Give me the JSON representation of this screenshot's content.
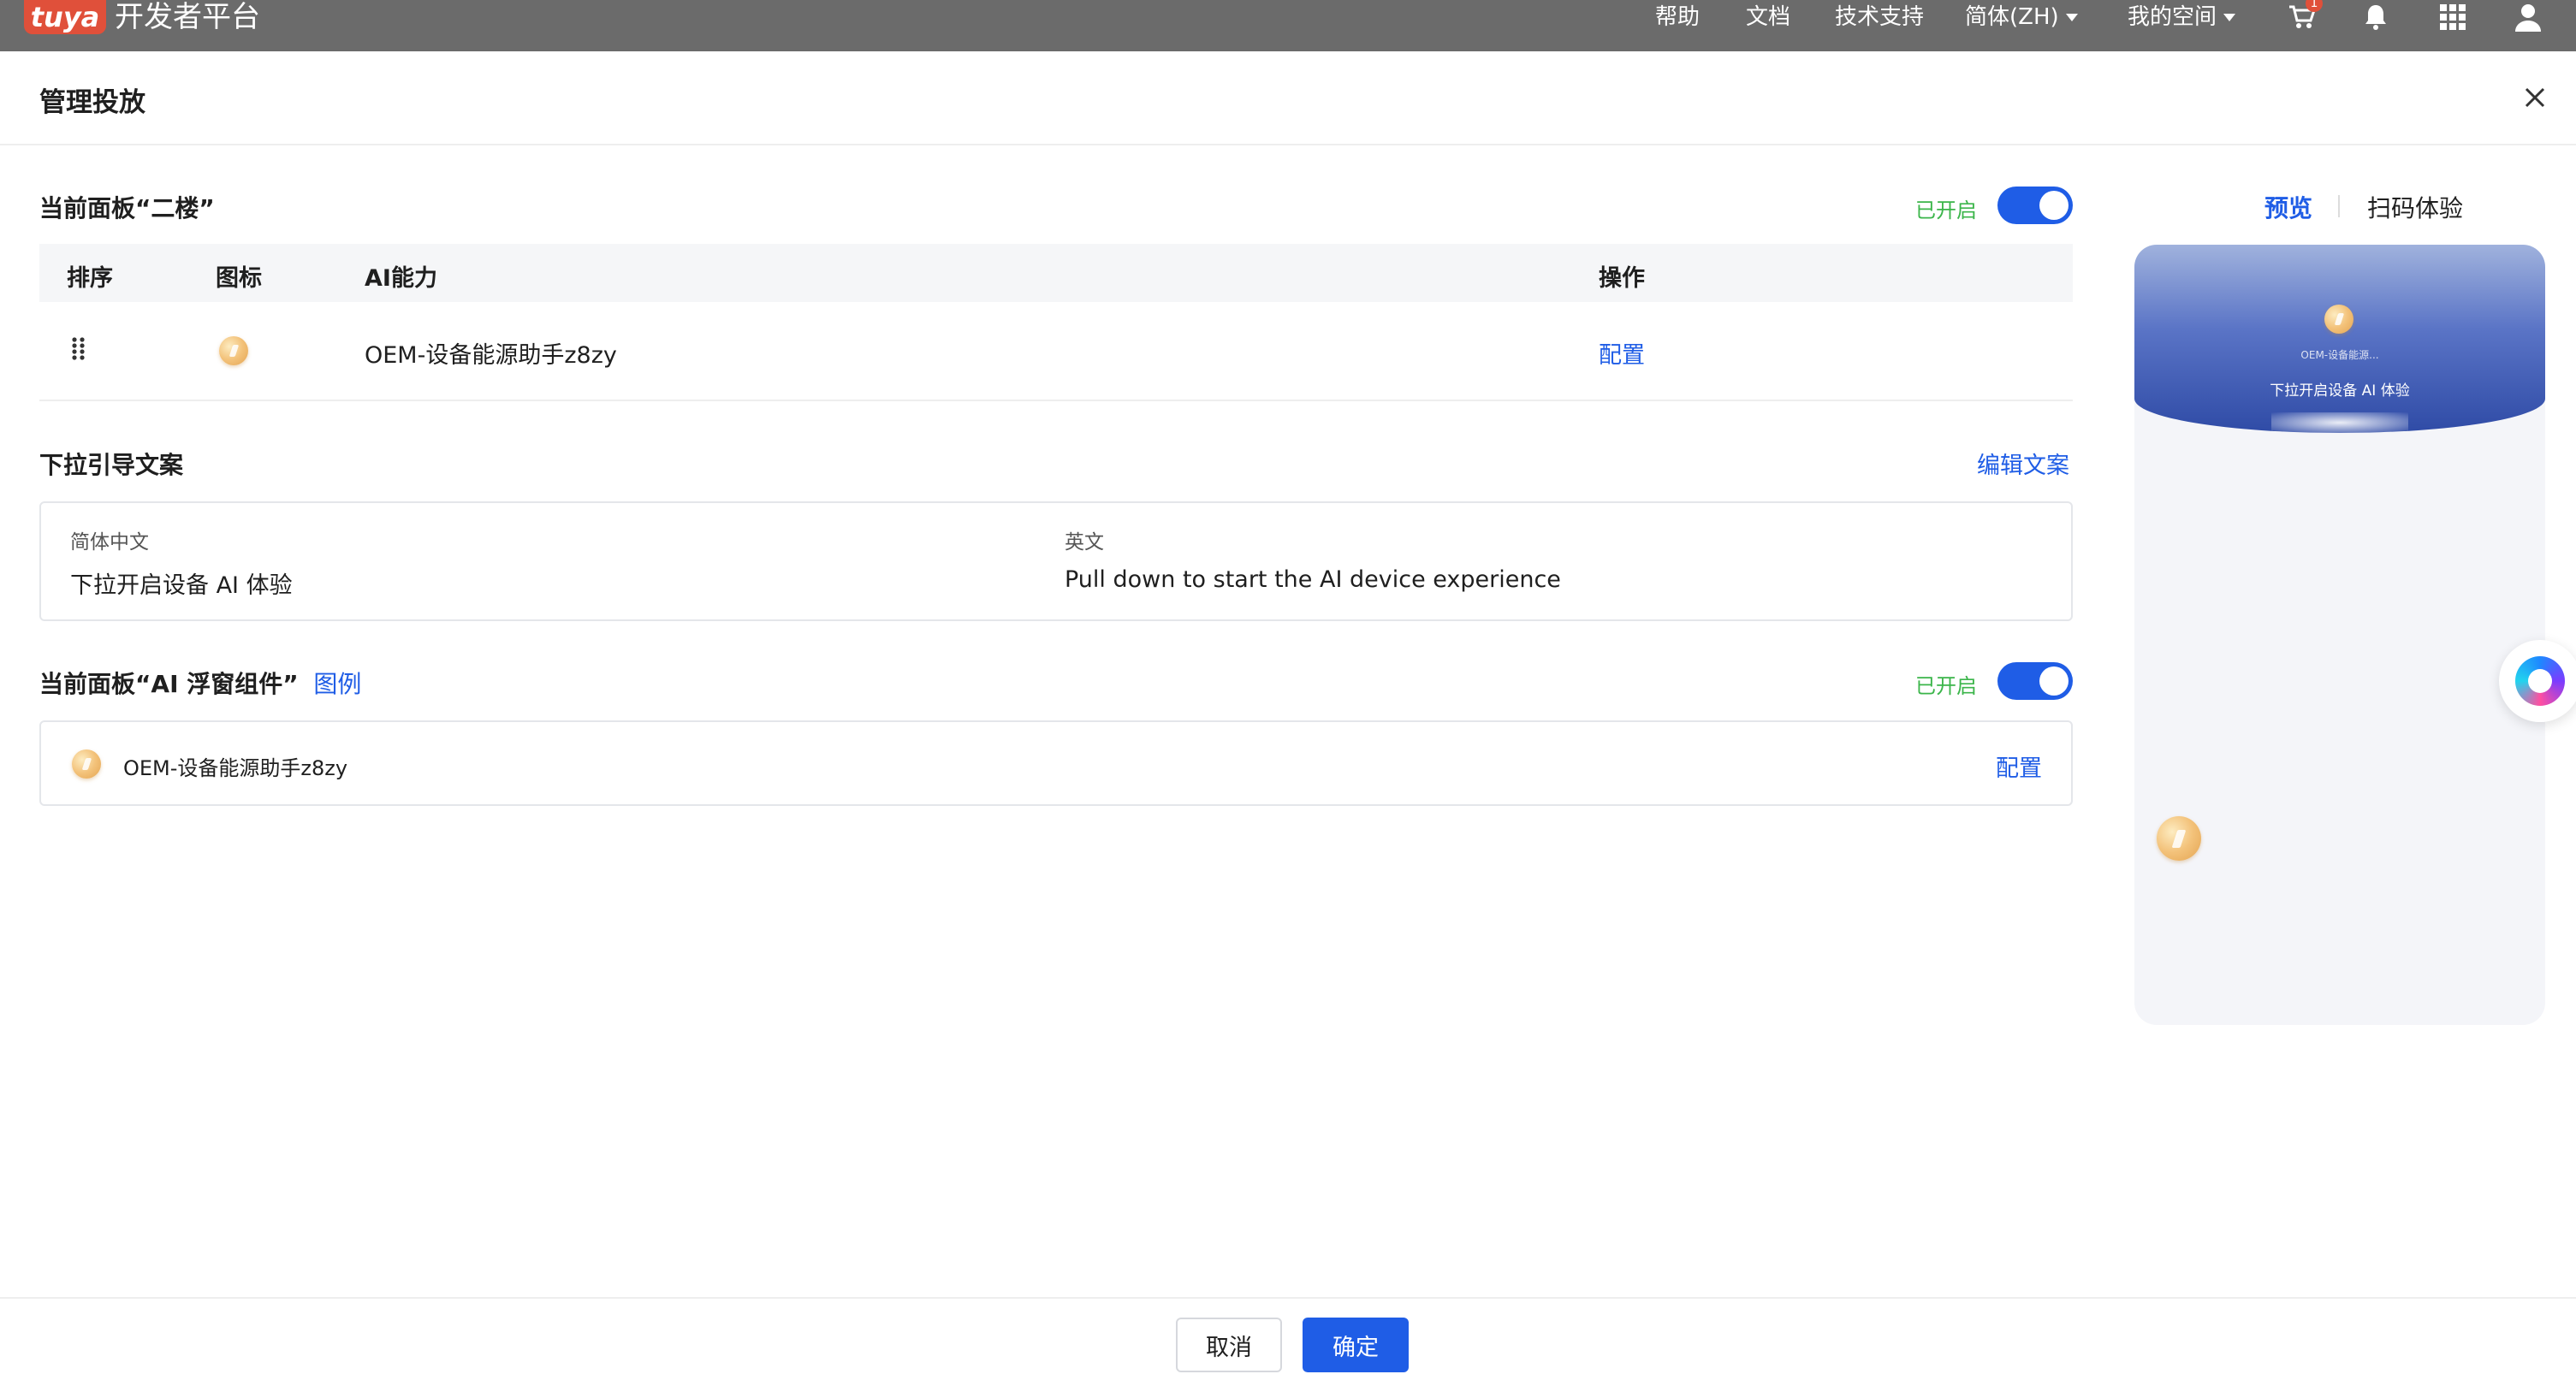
{
  "topbar": {
    "logo_text": "tuya",
    "brand": "开发者平台",
    "nav": [
      "帮助",
      "文档",
      "技术支持"
    ],
    "language": "简体(ZH)",
    "workspace": "我的空间",
    "cart_badge": "1",
    "icons": [
      "cart-icon",
      "bell-icon",
      "apps-grid-icon",
      "user-icon"
    ]
  },
  "modal": {
    "title": "管理投放"
  },
  "panel1": {
    "title": "当前面板“二楼”",
    "status": "已开启",
    "toggle_on": true,
    "columns": [
      "排序",
      "图标",
      "AI能力",
      "操作"
    ],
    "rows": [
      {
        "name": "OEM-设备能源助手z8zy",
        "action": "配置"
      }
    ]
  },
  "pulldown": {
    "title": "下拉引导文案",
    "edit": "编辑文案",
    "zh_label": "简体中文",
    "zh_value": "下拉开启设备 AI 体验",
    "en_label": "英文",
    "en_value": "Pull down to start the AI device experience"
  },
  "panel2": {
    "title": "当前面板“AI 浮窗组件”",
    "legend_link": "图例",
    "status": "已开启",
    "toggle_on": true,
    "item_name": "OEM-设备能源助手z8zy",
    "action": "配置"
  },
  "preview": {
    "tab_preview": "预览",
    "tab_scan": "扫码体验",
    "phone_small": "OEM-设备能源...",
    "phone_text": "下拉开启设备 AI 体验"
  },
  "footer": {
    "cancel": "取消",
    "confirm": "确定"
  },
  "colors": {
    "primary": "#1f5de6",
    "status_green": "#3bb54a",
    "topbar": "#6b6b6b"
  }
}
